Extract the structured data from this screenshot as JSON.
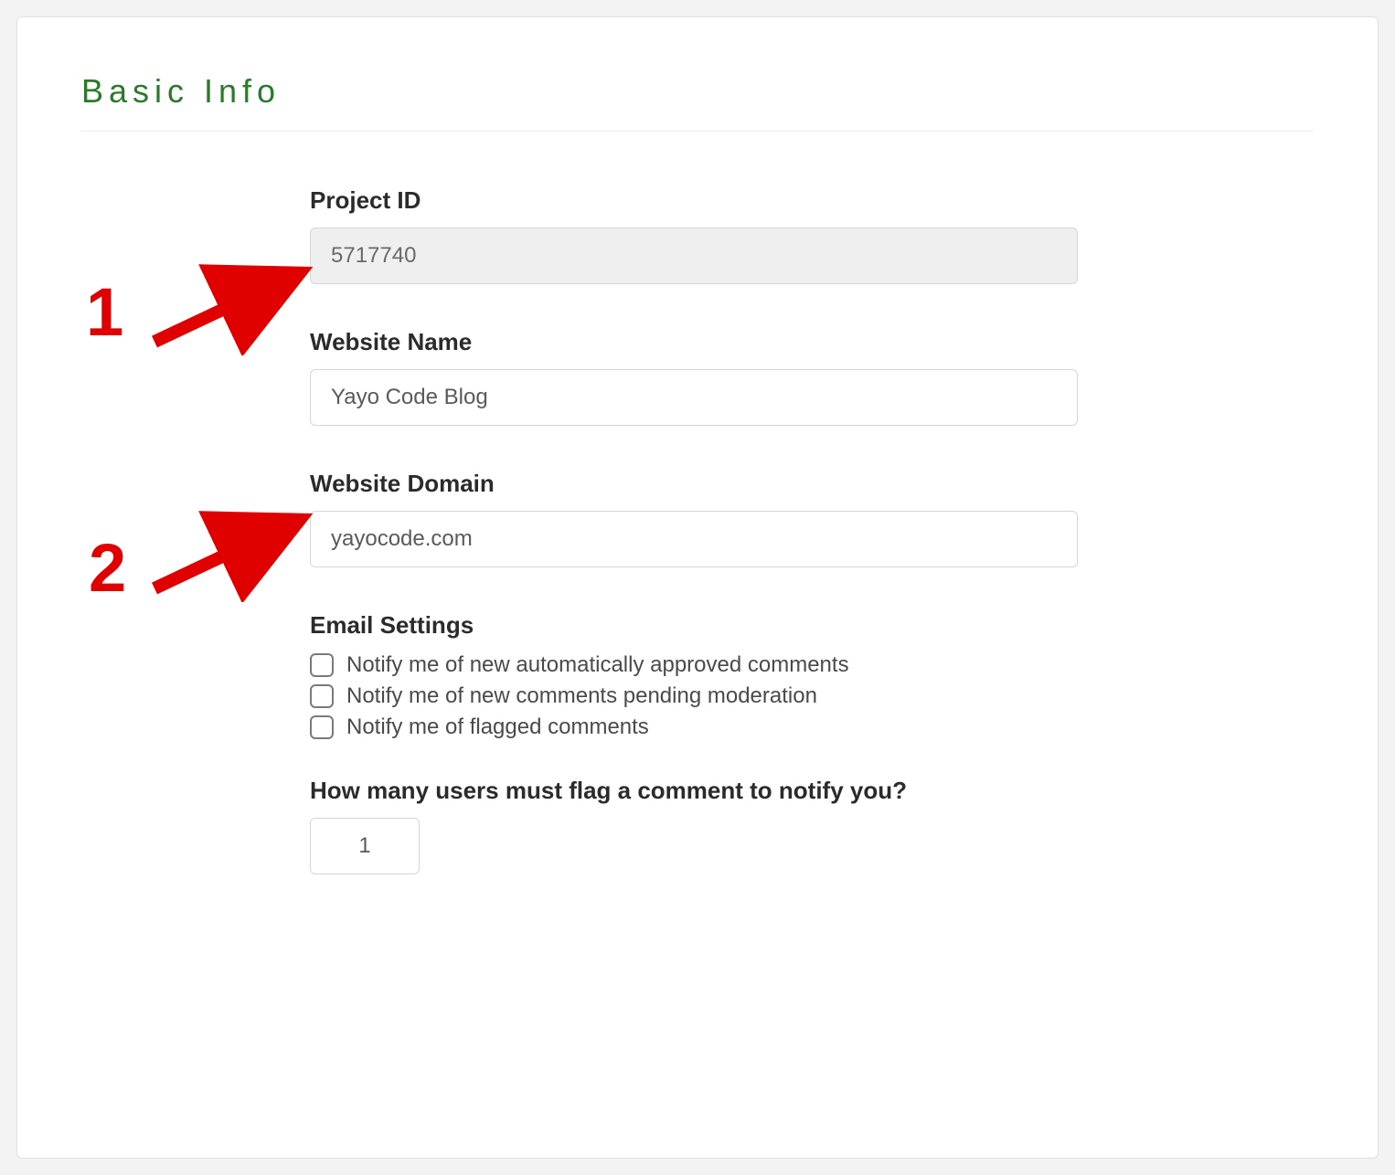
{
  "section_title": "Basic Info",
  "fields": {
    "project_id": {
      "label": "Project ID",
      "value": "5717740"
    },
    "website_name": {
      "label": "Website Name",
      "value": "Yayo Code Blog"
    },
    "website_domain": {
      "label": "Website Domain",
      "value": "yayocode.com"
    }
  },
  "email_settings": {
    "label": "Email Settings",
    "options": [
      "Notify me of new automatically approved comments",
      "Notify me of new comments pending moderation",
      "Notify me of flagged comments"
    ]
  },
  "flag_threshold": {
    "label": "How many users must flag a comment to notify you?",
    "value": "1"
  },
  "annotations": {
    "n1": "1",
    "n2": "2"
  }
}
